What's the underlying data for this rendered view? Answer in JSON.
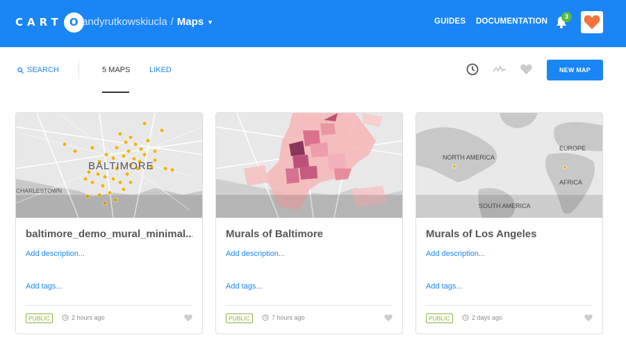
{
  "header": {
    "logo_text": "CART",
    "logo_o": "O",
    "user": "andyrutkowskiucla",
    "separator": "/",
    "section": "Maps",
    "links": [
      "GUIDES",
      "DOCUMENTATION"
    ],
    "notifications": "3",
    "colors": {
      "bar": "#1a85f5",
      "badge": "#55b94a",
      "heart": "#f2733d"
    }
  },
  "toolbar": {
    "search_label": "SEARCH",
    "tab_maps": "5 MAPS",
    "tab_liked": "LIKED",
    "new_map_label": "NEW MAP",
    "icons": [
      "clock-icon",
      "activity-icon",
      "heart-icon"
    ]
  },
  "cards": [
    {
      "title": "baltimore_demo_mural_minimal...",
      "map_label": "BALTIMORE",
      "map_sublabel": "CHARLESTOWN",
      "description": "Add description...",
      "tags": "Add tags...",
      "privacy": "PUBLIC",
      "updated": "2 hours ago"
    },
    {
      "title": "Murals of Baltimore",
      "description": "Add description...",
      "tags": "Add tags...",
      "privacy": "PUBLIC",
      "updated": "7 hours ago"
    },
    {
      "title": "Murals of Los Angeles",
      "map_labels": [
        "NORTH AMERICA",
        "EUROPE",
        "AFRICA",
        "SOUTH AMERICA"
      ],
      "description": "Add description...",
      "tags": "Add tags...",
      "privacy": "PUBLIC",
      "updated": "2 days ago"
    }
  ]
}
